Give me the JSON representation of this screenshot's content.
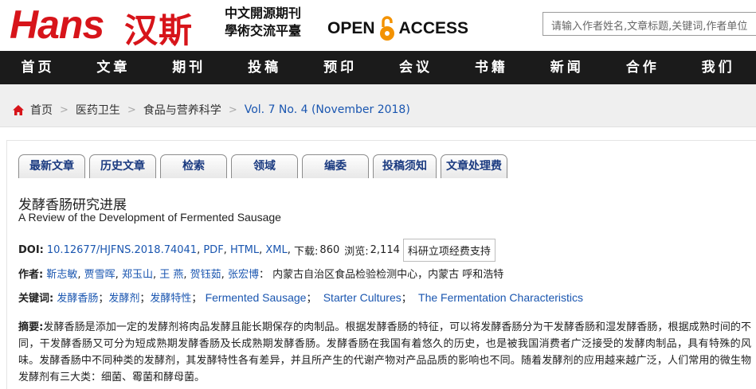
{
  "header": {
    "logo_latin": "Hans",
    "logo_cn": "汉斯",
    "slogan_line1": "中文開源期刊",
    "slogan_line2": "學術交流平臺",
    "open_access_left": "OPEN",
    "open_access_right": "ACCESS",
    "search_placeholder": "请输入作者姓名,文章标题,关键词,作者单位"
  },
  "nav": {
    "items": [
      "首页",
      "文章",
      "期刊",
      "投稿",
      "预印",
      "会议",
      "书籍",
      "新闻",
      "合作",
      "我们"
    ]
  },
  "breadcrumb": {
    "items": [
      "首页",
      "医药卫生",
      "食品与营养科学",
      "Vol. 7 No. 4 (November 2018)"
    ],
    "separator": ">"
  },
  "tabs": [
    "最新文章",
    "历史文章",
    "检索",
    "领域",
    "编委",
    "投稿须知",
    "文章处理费"
  ],
  "article": {
    "title_cn": "发酵香肠研究进展",
    "title_en": "A Review of the Development of Fermented Sausage",
    "doi_label": "DOI:",
    "doi": "10.12677/HJFNS.2018.74041",
    "formats": [
      "PDF",
      "HTML",
      "XML"
    ],
    "downloads_label": "下载:",
    "downloads": "860",
    "views_label": "浏览:",
    "views": "2,114",
    "fund_label": "科研立项经费支持",
    "authors_label": "作者:",
    "authors": [
      "靳志敏",
      "贾雪晖",
      "郑玉山",
      "王 燕",
      "贺钰茹",
      "张宏博"
    ],
    "affiliation": "内蒙古自治区食品检验检测中心，内蒙古 呼和浩特",
    "keywords_label": "关键词:",
    "keywords": [
      "发酵香肠",
      "发酵剂",
      "发酵特性",
      "Fermented Sausage",
      "Starter Cultures",
      "The Fermentation Characteristics"
    ],
    "abstract_label": "摘要:",
    "abstract": "发酵香肠是添加一定的发酵剂将肉品发酵且能长期保存的肉制品。根据发酵香肠的特征，可以将发酵香肠分为干发酵香肠和湿发酵香肠，根据成熟时间的不同，干发酵香肠又可分为短成熟期发酵香肠及长成熟期发酵香肠。发酵香肠在我国有着悠久的历史，也是被我国消费者广泛接受的发酵肉制品，具有特殊的风味。发酵香肠中不同种类的发酵剂，其发酵特性各有差异，并且所产生的代谢产物对产品品质的影响也不同。随着发酵剂的应用越来越广泛，人们常用的微生物发酵剂有三大类：细菌、霉菌和酵母菌。"
  },
  "colors": {
    "brand_red": "#d7141a",
    "nav_bg": "#1b1b1b",
    "link_blue": "#1a56b0"
  },
  "icons": {
    "home": "home-icon",
    "open_access": "open-lock-icon"
  }
}
